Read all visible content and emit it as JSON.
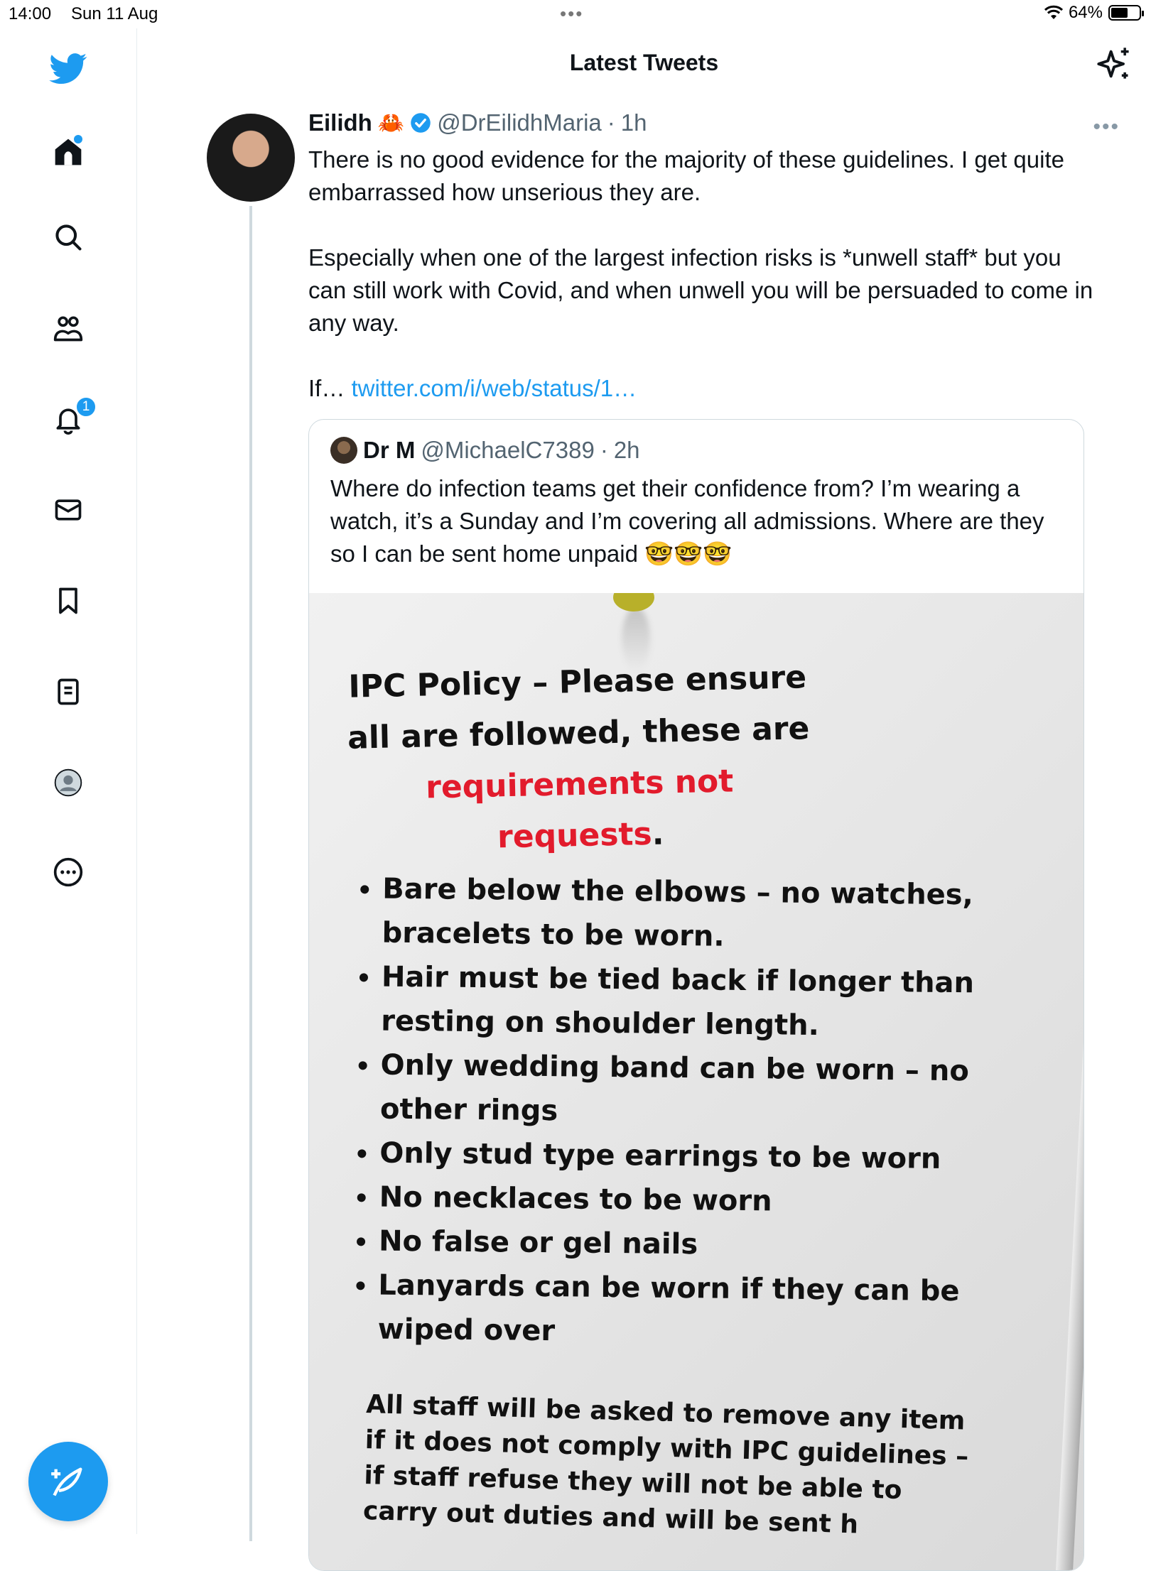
{
  "status_bar": {
    "time": "14:00",
    "date": "Sun 11 Aug",
    "dots": "•••",
    "battery": "64%",
    "battery_level": 0.64
  },
  "sidebar": {
    "items": [
      {
        "name": "home",
        "icon": "home-icon"
      },
      {
        "name": "search",
        "icon": "search-icon"
      },
      {
        "name": "communities",
        "icon": "people-icon"
      },
      {
        "name": "notifications",
        "icon": "bell-icon",
        "badge": "1"
      },
      {
        "name": "messages",
        "icon": "mail-icon"
      },
      {
        "name": "bookmarks",
        "icon": "bookmark-icon"
      },
      {
        "name": "lists",
        "icon": "list-icon"
      },
      {
        "name": "profile",
        "icon": "profile-icon"
      },
      {
        "name": "more",
        "icon": "more-circle-icon"
      }
    ],
    "compose_icon": "compose-tweet-icon"
  },
  "header": {
    "title": "Latest Tweets",
    "sparkle_icon": "sparkle-icon"
  },
  "tweet": {
    "name": "Eilidh",
    "emoji": "🦀",
    "handle": "@DrEilidhMaria",
    "sep": "·",
    "time": "1h",
    "more": "•••",
    "text": "There is no good evidence for the majority of these guidelines. I get quite embarrassed how unserious they are.\n\nEspecially when one of the largest infection risks is *unwell staff* but you can still work with Covid, and when unwell you will be persuaded to come in any way.\n\nIf… ",
    "link": "twitter.com/i/web/status/1…",
    "quote": {
      "name": "Dr M",
      "handle": "@MichaelC7389",
      "sep": "·",
      "time": "2h",
      "text": "Where do infection teams get their confidence from? I’m wearing a watch, it’s a Sunday and I’m covering all admissions. Where are they so I can be sent home unpaid 🤓🤓🤓",
      "image": {
        "heading_part1": "IPC Policy – Please ensure all are followed, these are ",
        "heading_red": "requirements not requests",
        "heading_end": ".",
        "bullets": [
          "Bare below the elbows – no watches, bracelets to be worn.",
          "Hair must be tied back if longer than resting on shoulder length.",
          "Only wedding band can be worn – no other rings",
          "Only stud type earrings to be worn",
          "No necklaces to be worn",
          "No false or gel nails",
          "Lanyards can be worn if they can be wiped over"
        ],
        "footer": "All staff will be asked to remove any item if it does not comply with IPC guidelines – if staff refuse they will not be able to carry out duties and will be sent h"
      }
    }
  },
  "colors": {
    "accent": "#1d9bf0",
    "text": "#0f1419",
    "muted": "#536471",
    "border": "#cfd9de",
    "notice_red": "#e21b2c"
  }
}
